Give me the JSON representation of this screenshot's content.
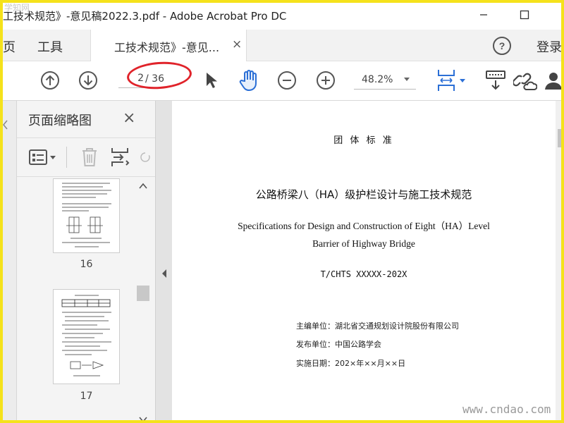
{
  "window": {
    "title": "工技术规范》-意见稿2022.3.pdf - Adobe Acrobat Pro DC",
    "watermark_top": "学知网",
    "controls": {
      "minimize": "minimize-icon",
      "maximize": "maximize-icon"
    }
  },
  "tabs": {
    "home": "页",
    "tools": "工具",
    "doc_tab": "工技术规范》-意见...",
    "doc_tab_close": "×",
    "login": "登录"
  },
  "toolbar": {
    "current_page": "2",
    "total_pages": "/ 36",
    "zoom": "48.2%"
  },
  "panel": {
    "title": "页面缩略图",
    "close": "×",
    "thumbnails": [
      {
        "label": "16"
      },
      {
        "label": "17"
      }
    ]
  },
  "document": {
    "category": "团 体 标 准",
    "title_cn": "公路桥梁八（HA）级护栏设计与施工技术规范",
    "title_en_1": "Specifications for Design and Construction of Eight（HA）Level",
    "title_en_2": "Barrier of Highway Bridge",
    "code": "T/CHTS XXXXX-202X",
    "editor": "主编单位：湖北省交通规划设计院股份有限公司",
    "publisher": "发布单位：中国公路学会",
    "date": "实施日期：202×年××月××日"
  },
  "footer": {
    "watermark": "www.cndao.com"
  },
  "colors": {
    "frame": "#f5e21b",
    "annotation": "#e0232a",
    "accent": "#2b6fd6"
  }
}
